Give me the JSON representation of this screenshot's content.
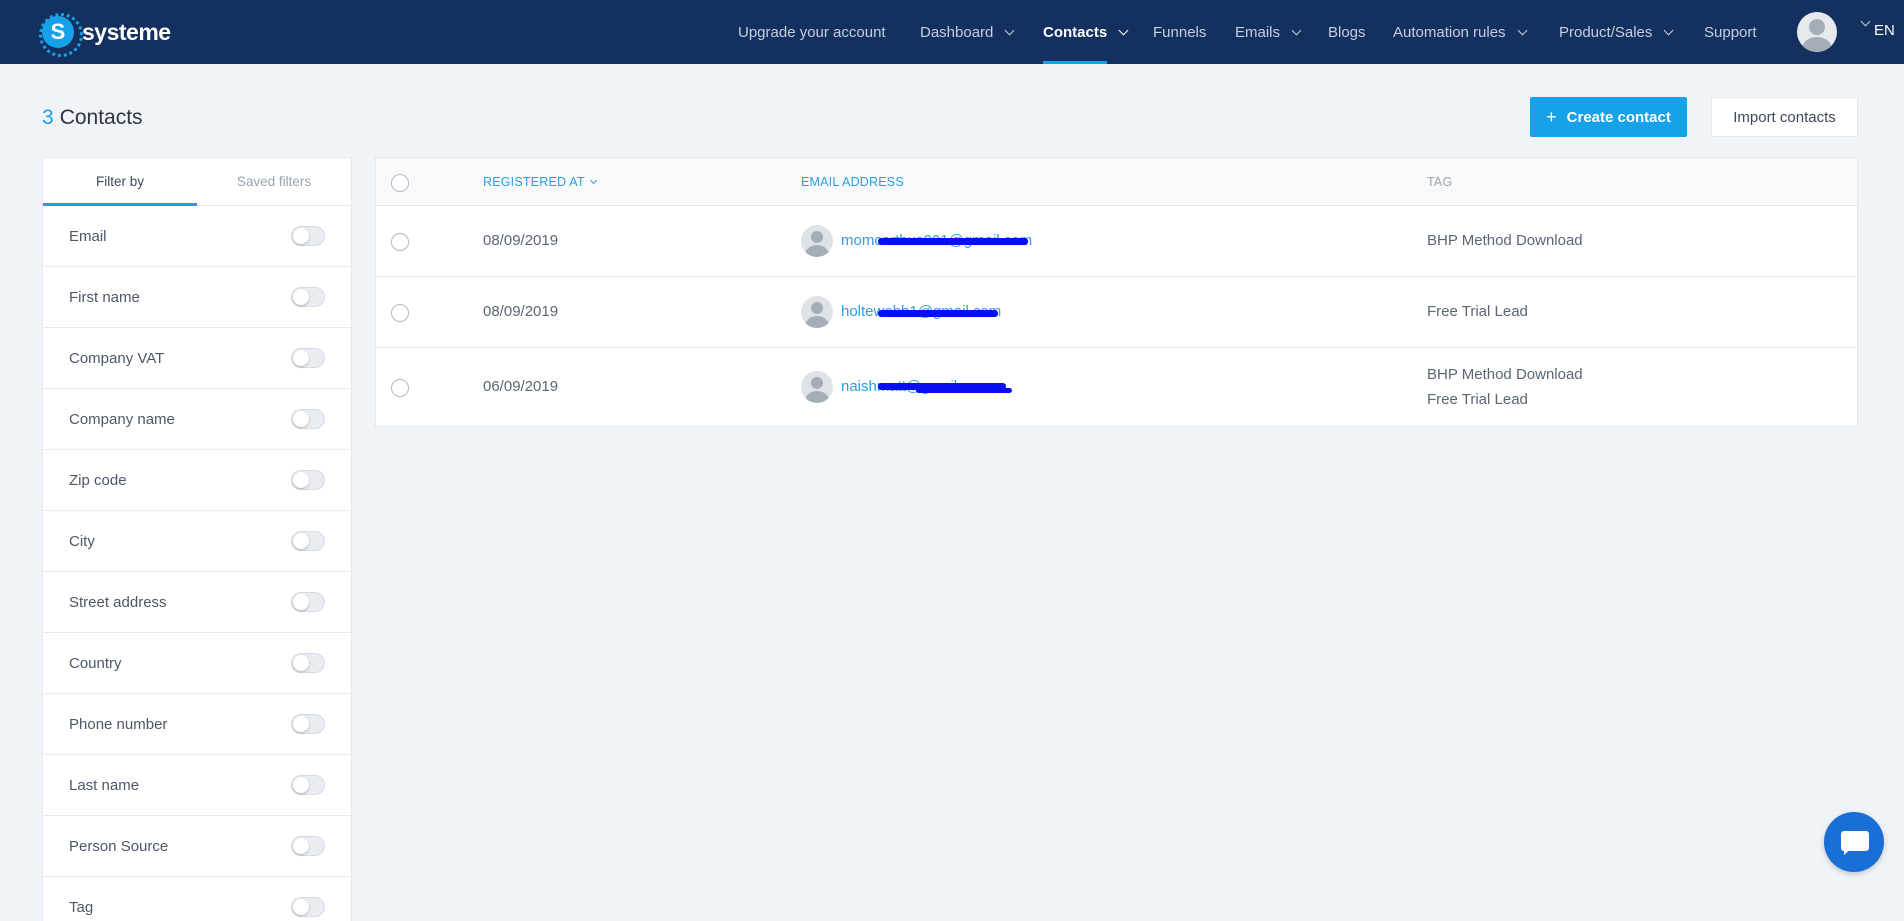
{
  "brand": {
    "name": "systeme",
    "logo_glyph": "S",
    "accent": "#15a2e8",
    "nav_bg": "#13305e"
  },
  "nav": {
    "items": [
      {
        "label": "Upgrade your account",
        "dropdown": false
      },
      {
        "label": "Dashboard",
        "dropdown": true
      },
      {
        "label": "Contacts",
        "dropdown": true,
        "active": true
      },
      {
        "label": "Funnels",
        "dropdown": false
      },
      {
        "label": "Emails",
        "dropdown": true
      },
      {
        "label": "Blogs",
        "dropdown": false
      },
      {
        "label": "Automation rules",
        "dropdown": true
      },
      {
        "label": "Product/Sales",
        "dropdown": true
      },
      {
        "label": "Support",
        "dropdown": false
      }
    ],
    "language": "EN"
  },
  "page": {
    "count": "3",
    "title": "Contacts",
    "create_button": "Create contact",
    "create_icon": "+",
    "import_button": "Import contacts"
  },
  "filters": {
    "tabs": [
      "Filter by",
      "Saved filters"
    ],
    "items": [
      "Email",
      "First name",
      "Company VAT",
      "Company name",
      "Zip code",
      "City",
      "Street address",
      "Country",
      "Phone number",
      "Last name",
      "Person Source",
      "Tag"
    ]
  },
  "table": {
    "headers": {
      "registered_at": "REGISTERED AT",
      "email": "EMAIL ADDRESS",
      "tag": "TAG"
    },
    "rows": [
      {
        "date": "08/09/2019",
        "email": "momcartbus001@gmail.com",
        "tags": [
          "BHP Method Download"
        ]
      },
      {
        "date": "08/09/2019",
        "email": "holtewebb1@gmail.com",
        "tags": [
          "Free Trial Lead"
        ]
      },
      {
        "date": "06/09/2019",
        "email": "naishmatt@gmail.com",
        "tags": [
          "BHP Method Download",
          "Free Trial Lead"
        ]
      }
    ]
  },
  "chat": {
    "icon": "chat-bubble-icon"
  }
}
